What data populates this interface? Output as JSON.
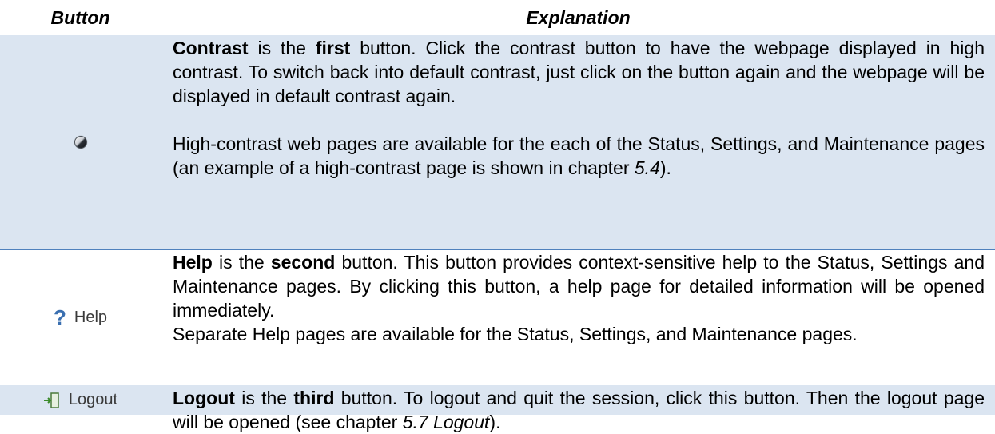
{
  "header": {
    "button": "Button",
    "explanation": "Explanation"
  },
  "rows": [
    {
      "icon": "contrast-icon",
      "p1": {
        "a": "Contrast",
        "b": " is the ",
        "c": "first",
        "d": " button. Click the contrast button to have the webpage displayed in high contrast. To switch back into default contrast, just click on the button again and the webpage will be displayed in default contrast again."
      },
      "p2": {
        "a": "High-contrast web pages are available for the each of the Status, Settings, and Maintenance pages (an example of a high-contrast page is shown in chapter ",
        "b": "5.4",
        "c": ")."
      }
    },
    {
      "icon": "help-icon",
      "button_label": "Help",
      "p1": {
        "a": "Help",
        "b": " is the ",
        "c": "second",
        "d": " button. This button provides context-sensitive help to the Status, Settings and Maintenance pages. By clicking this button, a help page for detailed information will be opened immediately."
      },
      "p2": "Separate Help pages are available for the Status, Settings, and Maintenance pages."
    },
    {
      "icon": "logout-icon",
      "button_label": "Logout",
      "p1": {
        "a": "Logout",
        "b": " is the ",
        "c": "third",
        "d": " button. To logout and quit the session, click this button. Then the logout page will be opened (see chapter ",
        "e": "5.7 Logout",
        "f": ")."
      }
    }
  ],
  "colors": {
    "row_shade": "#dbe5f1",
    "rule": "#4f81bd",
    "help_blue": "#3a6fb0"
  }
}
